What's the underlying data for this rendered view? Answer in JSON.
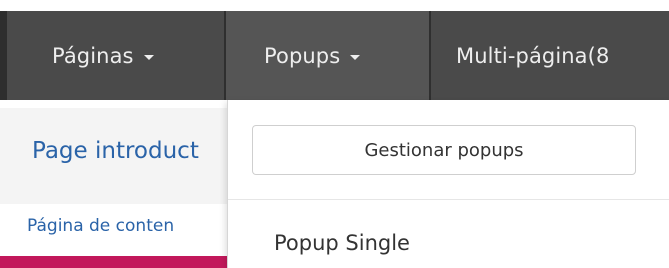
{
  "navbar": {
    "items": [
      {
        "label": "Páginas",
        "has_caret": true
      },
      {
        "label": "Popups",
        "has_caret": true
      },
      {
        "label": "Multi-página(8",
        "has_caret": false
      }
    ]
  },
  "background_content": {
    "title": "Page introduct",
    "link": "Página de conten"
  },
  "popups_menu": {
    "manage_button_label": "Gestionar popups",
    "items": [
      {
        "label": "Popup Single"
      }
    ]
  },
  "colors": {
    "navbar_bg": "#4a4a4a",
    "navbar_text": "#eeeeee",
    "link": "#2a63a8",
    "accent_bar": "#c2185b"
  }
}
